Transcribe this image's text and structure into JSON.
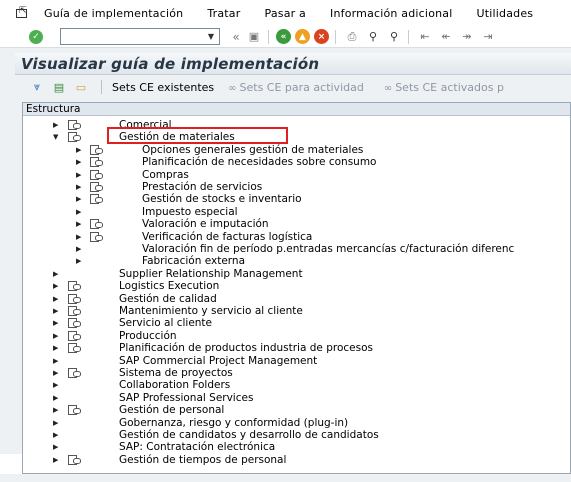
{
  "menubar": {
    "items": [
      "Guía de implementación",
      "Tratar",
      "Pasar a",
      "Información adicional",
      "Utilidades"
    ]
  },
  "toolbar": {
    "command_value": "",
    "icons": [
      "ok-icon",
      "dropdown-icon",
      "back-arrows-icon",
      "save-icon",
      "back-icon",
      "exit-icon",
      "cancel-icon",
      "print-icon",
      "find-icon",
      "find-next-icon",
      "first-page-icon",
      "previous-page-icon",
      "next-page-icon",
      "last-page-icon"
    ]
  },
  "title": "Visualizar guía de implementación",
  "app_toolbar": {
    "sets_ce": "Sets CE existentes",
    "sets_actividad": "Sets CE para actividad",
    "sets_activados": "Sets CE activados p"
  },
  "tree": {
    "header": "Estructura",
    "rows": [
      {
        "label": "Comercial",
        "level": 1,
        "arrow": "right",
        "icon": true
      },
      {
        "label": "Gestión de materiales",
        "level": 1,
        "arrow": "down",
        "icon": true
      },
      {
        "label": "Opciones generales gestión de materiales",
        "level": 2,
        "arrow": "right",
        "icon": true
      },
      {
        "label": "Planificación de necesidades sobre consumo",
        "level": 2,
        "arrow": "right",
        "icon": true
      },
      {
        "label": "Compras",
        "level": 2,
        "arrow": "right",
        "icon": true
      },
      {
        "label": "Prestación de servicios",
        "level": 2,
        "arrow": "right",
        "icon": true
      },
      {
        "label": "Gestión de stocks e inventario",
        "level": 2,
        "arrow": "right",
        "icon": true
      },
      {
        "label": "Impuesto especial",
        "level": 2,
        "arrow": "right",
        "icon": false
      },
      {
        "label": "Valoración e imputación",
        "level": 2,
        "arrow": "right",
        "icon": true
      },
      {
        "label": "Verificación de facturas logística",
        "level": 2,
        "arrow": "right",
        "icon": true
      },
      {
        "label": "Valoración fin de período p.entradas mercancías c/facturación diferenc",
        "level": 2,
        "arrow": "right",
        "icon": false
      },
      {
        "label": "Fabricación externa",
        "level": 2,
        "arrow": "right",
        "icon": false
      },
      {
        "label": "Supplier Relationship Management",
        "level": 1,
        "arrow": "right",
        "icon": false
      },
      {
        "label": "Logistics Execution",
        "level": 1,
        "arrow": "right",
        "icon": true
      },
      {
        "label": "Gestión de calidad",
        "level": 1,
        "arrow": "right",
        "icon": true
      },
      {
        "label": "Mantenimiento y servicio al cliente",
        "level": 1,
        "arrow": "right",
        "icon": true
      },
      {
        "label": "Servicio al cliente",
        "level": 1,
        "arrow": "right",
        "icon": true
      },
      {
        "label": "Producción",
        "level": 1,
        "arrow": "right",
        "icon": true
      },
      {
        "label": "Planificación de productos industria de procesos",
        "level": 1,
        "arrow": "right",
        "icon": true
      },
      {
        "label": "SAP Commercial Project Management",
        "level": 1,
        "arrow": "right",
        "icon": false
      },
      {
        "label": "Sistema de proyectos",
        "level": 1,
        "arrow": "right",
        "icon": true
      },
      {
        "label": "Collaboration Folders",
        "level": 1,
        "arrow": "right",
        "icon": false
      },
      {
        "label": "SAP Professional Services",
        "level": 1,
        "arrow": "right",
        "icon": false
      },
      {
        "label": "Gestión de personal",
        "level": 1,
        "arrow": "right",
        "icon": true
      },
      {
        "label": "Gobernanza, riesgo y conformidad (plug-in)",
        "level": 1,
        "arrow": "right",
        "icon": false
      },
      {
        "label": "Gestión de candidatos y desarrollo de candidatos",
        "level": 1,
        "arrow": "right",
        "icon": false
      },
      {
        "label": "SAP: Contratación electrónica",
        "level": 1,
        "arrow": "right",
        "icon": false
      },
      {
        "label": "Gestión de tiempos de personal",
        "level": 1,
        "arrow": "right",
        "icon": true
      }
    ]
  },
  "colors": {
    "highlight": "#e02020",
    "title_text": "#283745",
    "ok_green": "#4caf50"
  }
}
